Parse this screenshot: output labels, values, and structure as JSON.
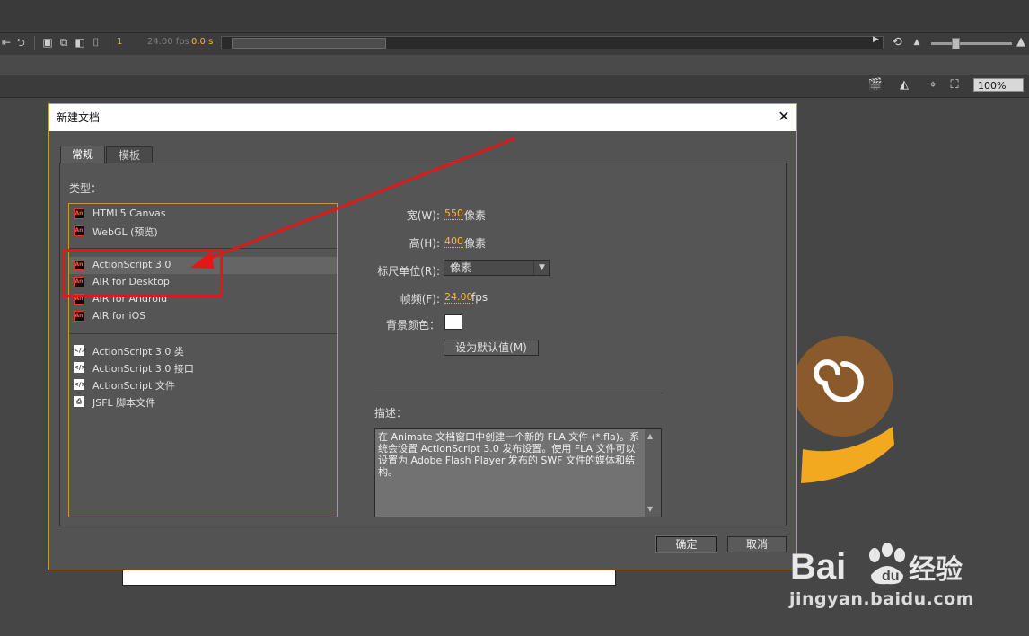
{
  "timeline": {
    "frame": "1",
    "fps": "24.00 fps",
    "time": "0.0 s"
  },
  "stage_toolbar": {
    "zoom": "100%"
  },
  "dialog": {
    "title": "新建文档",
    "tabs": [
      {
        "label": "常规",
        "active": true
      },
      {
        "label": "模板",
        "active": false
      }
    ],
    "type_label": "类型：",
    "groups": [
      [
        {
          "label": "HTML5 Canvas",
          "icon": "animate-icon"
        },
        {
          "label": "WebGL (预览)",
          "icon": "animate-icon"
        }
      ],
      [
        {
          "label": "ActionScript 3.0",
          "icon": "animate-icon",
          "selected": true
        },
        {
          "label": "AIR for Desktop",
          "icon": "animate-icon"
        },
        {
          "label": "AIR for Android",
          "icon": "animate-icon"
        },
        {
          "label": "AIR for iOS",
          "icon": "animate-icon"
        }
      ],
      [
        {
          "label": "ActionScript 3.0 类",
          "icon": "code-file-icon"
        },
        {
          "label": "ActionScript 3.0 接口",
          "icon": "code-file-icon"
        },
        {
          "label": "ActionScript 文件",
          "icon": "code-file-icon"
        },
        {
          "label": "JSFL 脚本文件",
          "icon": "script-file-icon"
        }
      ]
    ],
    "properties": {
      "width_label": "宽(W):",
      "width_value": "550",
      "width_unit": "像素",
      "height_label": "高(H):",
      "height_value": "400",
      "height_unit": "像素",
      "ruler_label": "标尺单位(R):",
      "ruler_value": "像素",
      "fps_label": "帧频(F):",
      "fps_value": "24.00",
      "fps_unit": "fps",
      "bg_label": "背景颜色：",
      "bg_color": "#ffffff",
      "default_button": "设为默认值(M)"
    },
    "description_label": "描述：",
    "description": "在 Animate 文档窗口中创建一个新的 FLA 文件 (*.fla)。系统会设置 ActionScript 3.0 发布设置。使用 FLA 文件可以设置为 Adobe Flash Player 发布的 SWF 文件的媒体和结构。",
    "ok_button": "确定",
    "cancel_button": "取消"
  },
  "colors": {
    "accent_orange": "#ffb340",
    "frame_gold": "#c69a3a",
    "annotation_red": "#e01818"
  },
  "watermark": {
    "logo": "Bai 经验",
    "url": "jingyan.baidu.com"
  }
}
